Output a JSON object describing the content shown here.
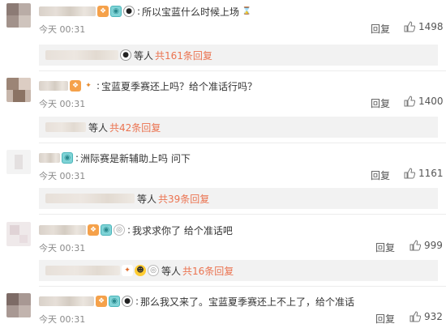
{
  "comments": [
    {
      "text": "所以宝蓝什么时候上场",
      "time": "今天 00:31",
      "reply_label": "回复",
      "likes": "1498",
      "badges": [
        "fire-badge",
        "eye-badge",
        "panda-badge"
      ],
      "trailing_icon": "hourglass-icon",
      "sub": {
        "deng": "等人",
        "more": "共161条回复"
      }
    },
    {
      "text": "宝蓝夏季赛还上吗？给个准话行吗？",
      "time": "今天 00:31",
      "reply_label": "回复",
      "likes": "1400",
      "badges": [
        "fire-badge",
        "fan-badge"
      ],
      "sub": {
        "deng": "等人",
        "more": "共42条回复"
      }
    },
    {
      "text": "洲际赛是新辅助上吗 问下",
      "time": "今天 00:31",
      "reply_label": "回复",
      "likes": "1161",
      "badges": [
        "eye-badge"
      ],
      "sub": {
        "deng": "等人",
        "more": "共39条回复"
      }
    },
    {
      "text": "我求求你了 给个准话吧",
      "time": "今天 00:31",
      "reply_label": "回复",
      "likes": "999",
      "badges": [
        "fire-badge",
        "eye-badge",
        "ring-badge"
      ],
      "sub": {
        "deng": "等人",
        "more": "共16条回复"
      }
    },
    {
      "text": "那么我又来了。宝蓝夏季赛还上不上了，给个准话",
      "time": "今天 00:31",
      "reply_label": "回复",
      "likes": "932",
      "badges": [
        "fire-badge",
        "eye-badge",
        "panda-badge"
      ]
    }
  ],
  "colors": {
    "link_orange": "#eb7350",
    "time_gray": "#8a8a8a",
    "subbox_bg": "#f2f2f2"
  }
}
